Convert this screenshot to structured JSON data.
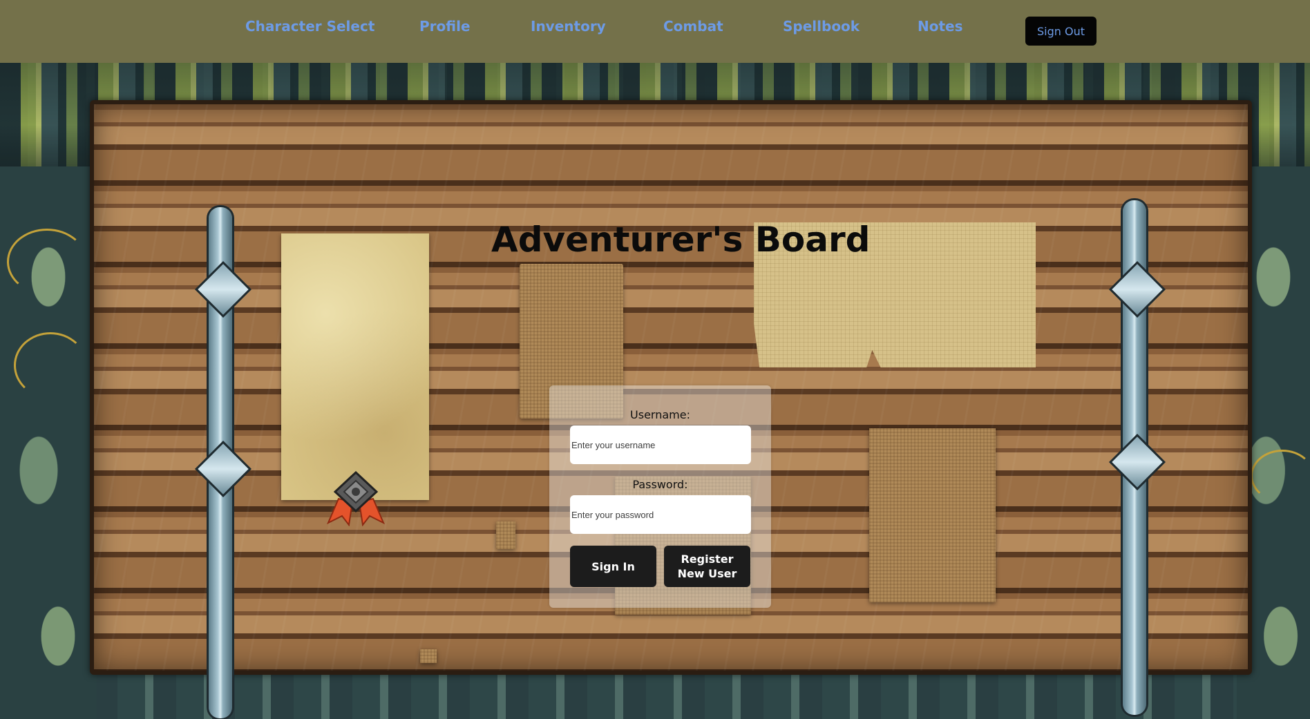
{
  "nav": {
    "links": [
      {
        "label": "Character Select"
      },
      {
        "label": "Profile"
      },
      {
        "label": "Inventory"
      },
      {
        "label": "Combat"
      },
      {
        "label": "Spellbook"
      },
      {
        "label": "Notes"
      }
    ],
    "sign_out_label": "Sign Out"
  },
  "main": {
    "title": "Adventurer's Board"
  },
  "login": {
    "username_label": "Username:",
    "username_placeholder": "Enter your username",
    "username_value": "",
    "password_label": "Password:",
    "password_placeholder": "Enter your password",
    "password_value": "",
    "sign_in_label": "Sign In",
    "register_label_line1": "Register",
    "register_label_line2": "New User"
  },
  "colors": {
    "nav_bg": "#74714a",
    "nav_link": "#6d9be6",
    "button_bg": "#1c1c1c",
    "signout_bg": "#050505"
  }
}
